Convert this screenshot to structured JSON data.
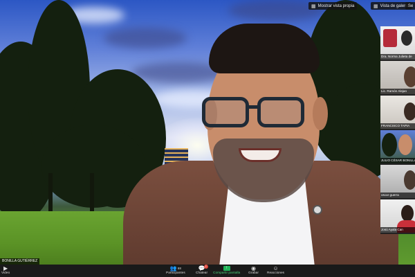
{
  "top_controls": {
    "own_view_label": "Mostrar vista propia",
    "gallery_view_label": "Vista de galería",
    "settings_label": "Se"
  },
  "participants": [
    {
      "name": "Dra. Norma Julieta de"
    },
    {
      "name": "Lic. Ramón Alejan"
    },
    {
      "name": "FRANCISCO TAPIA"
    },
    {
      "name": "JULIO CÉSAR BONILLA"
    },
    {
      "name": "oscar guerra"
    },
    {
      "name": "Josú Ayala Can"
    }
  ],
  "active_speaker": {
    "name": "BONILLA GUTIÉRREZ"
  },
  "toolbar": {
    "video_label": "Video",
    "participants_label": "Participantes",
    "participants_count": "68",
    "chat_label": "Chatear",
    "chat_badge": "2",
    "share_label": "Compartir pantalla",
    "record_label": "Grabar",
    "reactions_label": "Reacciones"
  },
  "colors": {
    "share_accent": "#22b45a",
    "active_speaker_border": "#e2c44a",
    "toolbar_bg": "#1a1a1a"
  }
}
